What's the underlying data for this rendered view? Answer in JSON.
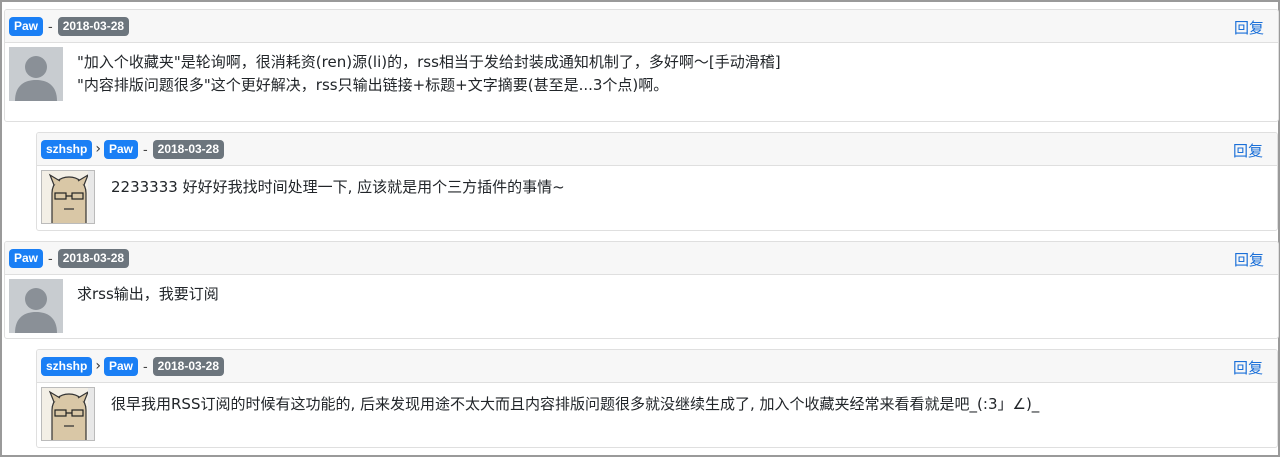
{
  "comments": [
    {
      "author": "Paw",
      "date": "2018-03-28",
      "reply_label": "回复",
      "avatar_icon": "default-user-avatar",
      "lines": [
        "\"加入个收藏夹\"是轮询啊，很消耗资(ren)源(li)的，rss相当于发给封装成通知机制了，多好啊～[手动滑稽]",
        "\"内容排版问题很多\"这个更好解决，rss只输出链接+标题+文字摘要(甚至是...3个点)啊。"
      ]
    },
    {
      "author": "szhshp",
      "reply_to": "Paw",
      "date": "2018-03-28",
      "reply_label": "回复",
      "avatar_icon": "cartoon-user-avatar",
      "lines": [
        "2233333 好好好我找时间处理一下, 应该就是用个三方插件的事情~"
      ]
    },
    {
      "author": "Paw",
      "date": "2018-03-28",
      "reply_label": "回复",
      "avatar_icon": "default-user-avatar",
      "lines": [
        "求rss输出，我要订阅"
      ]
    },
    {
      "author": "szhshp",
      "reply_to": "Paw",
      "date": "2018-03-28",
      "reply_label": "回复",
      "avatar_icon": "cartoon-user-avatar",
      "lines": [
        "很早我用RSS订阅的时候有这功能的, 后来发现用途不太大而且内容排版问题很多就没继续生成了, 加入个收藏夹经常来看看就是吧_(:3」∠)_"
      ]
    }
  ],
  "colors": {
    "badge_author": "#1a7ff5",
    "badge_date": "#6c757d",
    "reply_link": "#1a6fd8",
    "header_bg": "#f7f7f7"
  }
}
